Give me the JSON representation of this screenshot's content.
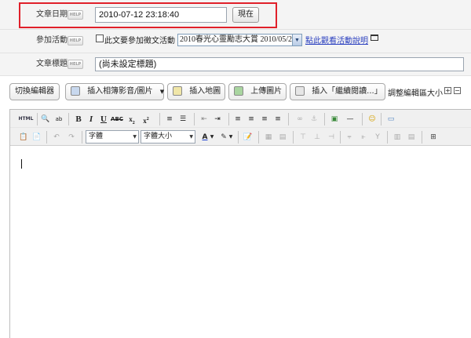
{
  "help_label": "HELP",
  "date_row": {
    "label": "文章日期",
    "value": "2010-07-12 23:18:40",
    "now_button": "現在"
  },
  "event_row": {
    "label": "參加活動",
    "checkbox_label": "此文要參加徵文活動",
    "select_value": "2010春光心靈勵志大賞 2010/05/2",
    "link_text": "點此觀看活動說明"
  },
  "title_row": {
    "label": "文章標題",
    "placeholder": "(尚未設定標題)"
  },
  "toolbar": {
    "toggle_editor": "切換編輯器",
    "insert_media": "插入相簿影音/圖片",
    "insert_map": "插入地圖",
    "upload_image": "上傳圖片",
    "insert_more": "插入「繼續閱讀...」",
    "resize_label": "調整編輯區大小"
  },
  "editor": {
    "html_label": "HTML",
    "font_family": "字體",
    "font_size": "字體大小"
  },
  "colors": {
    "highlight": "#e0202a",
    "link": "#2a3fbf"
  }
}
